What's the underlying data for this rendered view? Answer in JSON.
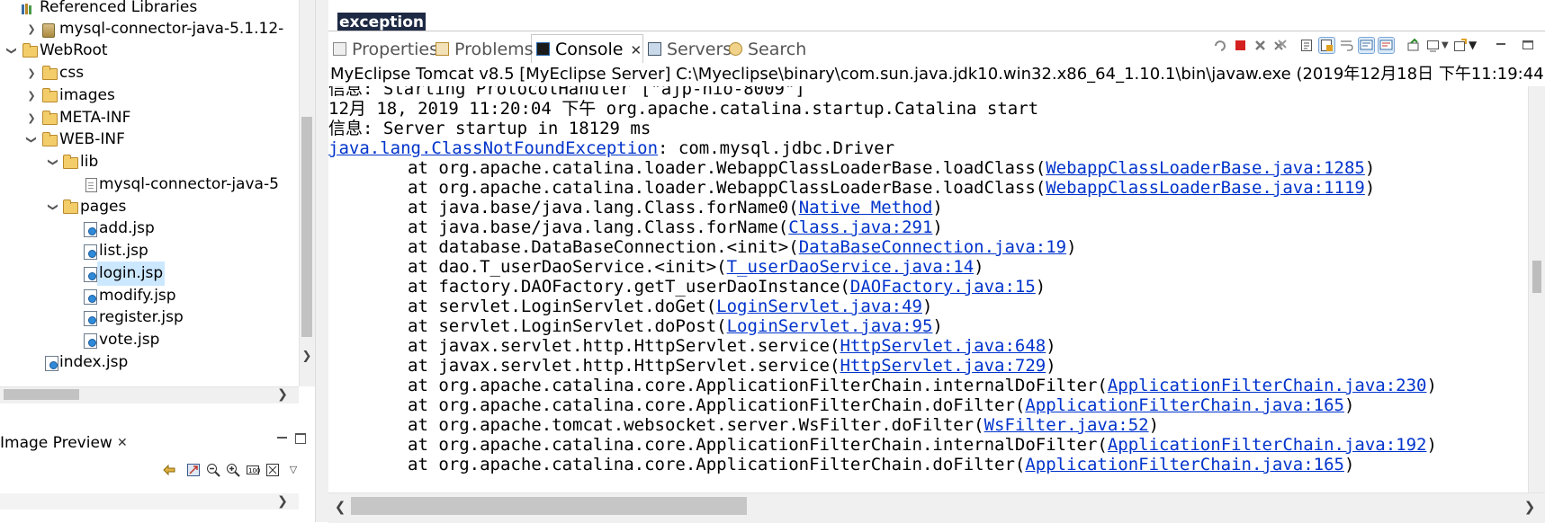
{
  "explorer": {
    "items": [
      {
        "label": "Referenced Libraries",
        "icon": "library-icon"
      },
      {
        "label": "mysql-connector-java-5.1.12-",
        "icon": "jar-icon"
      },
      {
        "label": "WebRoot",
        "icon": "folder-icon"
      },
      {
        "label": "css",
        "icon": "folder-icon"
      },
      {
        "label": "images",
        "icon": "folder-icon"
      },
      {
        "label": "META-INF",
        "icon": "folder-icon"
      },
      {
        "label": "WEB-INF",
        "icon": "folder-icon"
      },
      {
        "label": "lib",
        "icon": "folder-icon"
      },
      {
        "label": "mysql-connector-java-5",
        "icon": "file-icon"
      },
      {
        "label": "pages",
        "icon": "folder-icon"
      },
      {
        "label": "add.jsp",
        "icon": "jsp-file-icon"
      },
      {
        "label": "list.jsp",
        "icon": "jsp-file-icon"
      },
      {
        "label": "login.jsp",
        "icon": "jsp-file-icon",
        "selected": true
      },
      {
        "label": "modify.jsp",
        "icon": "jsp-file-icon"
      },
      {
        "label": "register.jsp",
        "icon": "jsp-file-icon"
      },
      {
        "label": "vote.jsp",
        "icon": "jsp-file-icon"
      },
      {
        "label": "index.jsp",
        "icon": "jsp-file-icon"
      }
    ]
  },
  "image_preview": {
    "tab_label": "Image Preview",
    "close_glyph": "✕"
  },
  "editor": {
    "visible_word": "exception"
  },
  "view_tabs": [
    {
      "label": "Properties",
      "icon": "properties-icon"
    },
    {
      "label": "Problems",
      "icon": "problems-icon"
    },
    {
      "label": "Console",
      "icon": "console-icon",
      "active": true,
      "close_glyph": "✕"
    },
    {
      "label": "Servers",
      "icon": "servers-icon"
    },
    {
      "label": "Search",
      "icon": "search-icon"
    }
  ],
  "console": {
    "title": "MyEclipse Tomcat v8.5 [MyEclipse Server] C:\\Myeclipse\\binary\\com.sun.java.jdk10.win32.x86_64_1.10.1\\bin\\javaw.exe (2019年12月18日 下午11:19:44)",
    "lines": [
      [
        {
          "t": "信息: Starting ProtocolHandler [\"ajp-nio-8009\"]"
        }
      ],
      [
        {
          "t": "12月 18, 2019 11:20:04 下午 org.apache.catalina.startup.Catalina start"
        }
      ],
      [
        {
          "t": "信息: Server startup in 18129 ms"
        }
      ],
      [
        {
          "t": "java.lang.ClassNotFoundException",
          "link": true
        },
        {
          "t": ": com.mysql.jdbc.Driver"
        }
      ],
      [
        {
          "t": "\tat org.apache.catalina.loader.WebappClassLoaderBase.loadClass("
        },
        {
          "t": "WebappClassLoaderBase.java:1285",
          "link": true
        },
        {
          "t": ")"
        }
      ],
      [
        {
          "t": "\tat org.apache.catalina.loader.WebappClassLoaderBase.loadClass("
        },
        {
          "t": "WebappClassLoaderBase.java:1119",
          "link": true
        },
        {
          "t": ")"
        }
      ],
      [
        {
          "t": "\tat java.base/java.lang.Class.forName0("
        },
        {
          "t": "Native Method",
          "link": true
        },
        {
          "t": ")"
        }
      ],
      [
        {
          "t": "\tat java.base/java.lang.Class.forName("
        },
        {
          "t": "Class.java:291",
          "link": true
        },
        {
          "t": ")"
        }
      ],
      [
        {
          "t": "\tat database.DataBaseConnection.<init>("
        },
        {
          "t": "DataBaseConnection.java:19",
          "link": true
        },
        {
          "t": ")"
        }
      ],
      [
        {
          "t": "\tat dao.T_userDaoService.<init>("
        },
        {
          "t": "T_userDaoService.java:14",
          "link": true
        },
        {
          "t": ")"
        }
      ],
      [
        {
          "t": "\tat factory.DAOFactory.getT_userDaoInstance("
        },
        {
          "t": "DAOFactory.java:15",
          "link": true
        },
        {
          "t": ")"
        }
      ],
      [
        {
          "t": "\tat servlet.LoginServlet.doGet("
        },
        {
          "t": "LoginServlet.java:49",
          "link": true
        },
        {
          "t": ")"
        }
      ],
      [
        {
          "t": "\tat servlet.LoginServlet.doPost("
        },
        {
          "t": "LoginServlet.java:95",
          "link": true
        },
        {
          "t": ")"
        }
      ],
      [
        {
          "t": "\tat javax.servlet.http.HttpServlet.service("
        },
        {
          "t": "HttpServlet.java:648",
          "link": true
        },
        {
          "t": ")"
        }
      ],
      [
        {
          "t": "\tat javax.servlet.http.HttpServlet.service("
        },
        {
          "t": "HttpServlet.java:729",
          "link": true
        },
        {
          "t": ")"
        }
      ],
      [
        {
          "t": "\tat org.apache.catalina.core.ApplicationFilterChain.internalDoFilter("
        },
        {
          "t": "ApplicationFilterChain.java:230",
          "link": true
        },
        {
          "t": ")"
        }
      ],
      [
        {
          "t": "\tat org.apache.catalina.core.ApplicationFilterChain.doFilter("
        },
        {
          "t": "ApplicationFilterChain.java:165",
          "link": true
        },
        {
          "t": ")"
        }
      ],
      [
        {
          "t": "\tat org.apache.tomcat.websocket.server.WsFilter.doFilter("
        },
        {
          "t": "WsFilter.java:52",
          "link": true
        },
        {
          "t": ")"
        }
      ],
      [
        {
          "t": "\tat org.apache.catalina.core.ApplicationFilterChain.internalDoFilter("
        },
        {
          "t": "ApplicationFilterChain.java:192",
          "link": true
        },
        {
          "t": ")"
        }
      ],
      [
        {
          "t": "\tat org.apache.catalina.core.ApplicationFilterChain.doFilter("
        },
        {
          "t": "ApplicationFilterChain.java:165",
          "link": true
        },
        {
          "t": ")"
        }
      ]
    ]
  },
  "colors": {
    "link": "#0033cc",
    "selection": "#cce8ff",
    "editor_highlight": "#1e2a44"
  }
}
